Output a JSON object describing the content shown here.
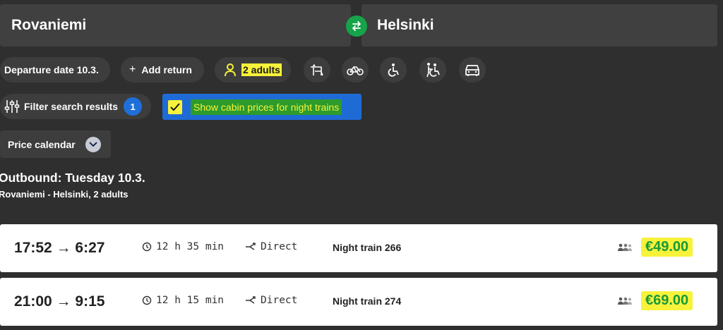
{
  "search": {
    "from": "Rovaniemi",
    "to": "Helsinki"
  },
  "chips": {
    "departure": "Departure date 10.3.",
    "add_return": "Add return",
    "passengers": "2 adults",
    "filter": "Filter search results",
    "filter_count": "1",
    "cabin_prices": "Show cabin prices for night trains",
    "price_calendar": "Price calendar"
  },
  "icons": [
    "pet-icon",
    "bicycle-icon",
    "wheelchair-icon",
    "accessible-assist-icon",
    "car-icon"
  ],
  "results": {
    "heading": "Outbound: Tuesday 10.3.",
    "subheading": "Rovaniemi - Helsinki, 2 adults",
    "trains": [
      {
        "depart": "17:52",
        "arrow": "→",
        "arrive": "6:27",
        "duration": "12 h 35 min",
        "transfer": "Direct",
        "name": "Night train 266",
        "price": "€49.00"
      },
      {
        "depart": "21:00",
        "arrow": "→",
        "arrive": "9:15",
        "duration": "12 h 15 min",
        "transfer": "Direct",
        "name": "Night train 274",
        "price": "€69.00"
      }
    ]
  },
  "colors": {
    "accent": "#16a34a",
    "highlight": "#f7f23a",
    "badge": "#1e6fd9",
    "price": "#179a3a"
  }
}
